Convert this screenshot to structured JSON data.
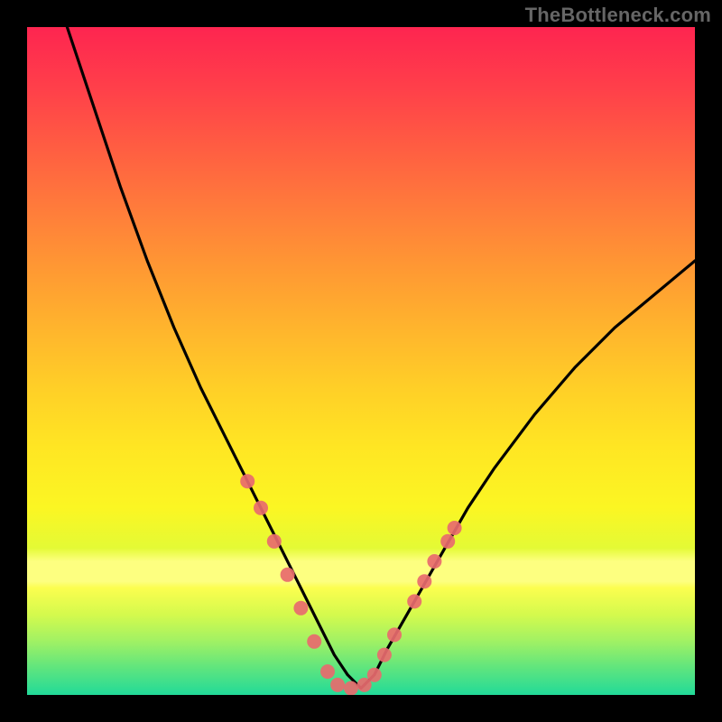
{
  "attribution": "TheBottleneck.com",
  "chart_data": {
    "type": "line",
    "title": "",
    "xlabel": "",
    "ylabel": "",
    "xlim": [
      0,
      100
    ],
    "ylim": [
      0,
      100
    ],
    "grid": false,
    "legend": false,
    "series": [
      {
        "name": "bottleneck-curve",
        "color": "#000000",
        "x": [
          6,
          10,
          14,
          18,
          22,
          26,
          30,
          33,
          36,
          38,
          40,
          42,
          44,
          46,
          48,
          50,
          52,
          54,
          58,
          62,
          66,
          70,
          76,
          82,
          88,
          94,
          100
        ],
        "y": [
          100,
          88,
          76,
          65,
          55,
          46,
          38,
          32,
          26,
          22,
          18,
          14,
          10,
          6,
          3,
          1,
          3,
          7,
          14,
          21,
          28,
          34,
          42,
          49,
          55,
          60,
          65
        ]
      }
    ],
    "markers": {
      "name": "highlight-dots",
      "color": "#e86a6e",
      "radius_px": 8,
      "points": [
        {
          "x": 33,
          "y": 32
        },
        {
          "x": 35,
          "y": 28
        },
        {
          "x": 37,
          "y": 23
        },
        {
          "x": 39,
          "y": 18
        },
        {
          "x": 41,
          "y": 13
        },
        {
          "x": 43,
          "y": 8
        },
        {
          "x": 45,
          "y": 3.5
        },
        {
          "x": 46.5,
          "y": 1.5
        },
        {
          "x": 48.5,
          "y": 1
        },
        {
          "x": 50.5,
          "y": 1.5
        },
        {
          "x": 52,
          "y": 3
        },
        {
          "x": 53.5,
          "y": 6
        },
        {
          "x": 55,
          "y": 9
        },
        {
          "x": 58,
          "y": 14
        },
        {
          "x": 59.5,
          "y": 17
        },
        {
          "x": 61,
          "y": 20
        },
        {
          "x": 63,
          "y": 23
        },
        {
          "x": 64,
          "y": 25
        }
      ]
    }
  }
}
